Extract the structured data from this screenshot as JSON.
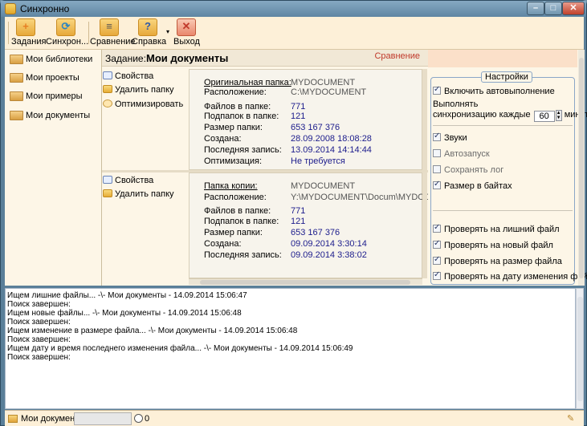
{
  "window": {
    "title": "Синхронно"
  },
  "toolbar": {
    "buttons": [
      {
        "label": "Задания",
        "icon": "plus-folder-icon",
        "glyph": "+",
        "color": "#e67e22"
      },
      {
        "label": "Синхрон...",
        "icon": "sync-folder-icon",
        "glyph": "⟳",
        "color": "#2e86c1"
      },
      {
        "label": "Сравнение",
        "icon": "compare-folder-icon",
        "glyph": "≡",
        "color": "#555555"
      },
      {
        "label": "Справка",
        "icon": "help-folder-icon",
        "glyph": "?",
        "color": "#2e5aa8"
      },
      {
        "label": "Выход",
        "icon": "exit-icon",
        "glyph": "✕",
        "color": "#c0392b"
      }
    ]
  },
  "libraries": [
    "Мои библиотеки",
    "Мои проекты",
    "Мои примеры",
    "Мои документы"
  ],
  "task": {
    "label": "Задание:",
    "name": "Мои документы",
    "mode": "Сравнение"
  },
  "original": {
    "actions": [
      "Свойства",
      "Удалить папку",
      "Оптимизировать"
    ],
    "title_key": "Оригинальная папка:",
    "title_val": "MYDOCUMENT",
    "location_key": "Расположение:",
    "location_val": "C:\\MYDOCUMENT",
    "files_key": "Файлов в папке:",
    "files_val": "771",
    "subfolders_key": "Подпапок в папке:",
    "subfolders_val": "121",
    "size_key": "Размер папки:",
    "size_val": "653 167 376",
    "created_key": "Создана:",
    "created_val": "28.09.2008 18:08:28",
    "modified_key": "Последняя запись:",
    "modified_val": "13.09.2014 14:14:44",
    "optimize_key": "Оптимизация:",
    "optimize_val": "Не требуется"
  },
  "copy": {
    "actions": [
      "Свойства",
      "Удалить папку"
    ],
    "title_key": "Папка копии:",
    "title_val": "MYDOCUMENT",
    "location_key": "Расположение:",
    "location_val": "Y:\\MYDOCUMENT\\Docum\\MYDOCUMEN",
    "files_key": "Файлов в папке:",
    "files_val": "771",
    "subfolders_key": "Подпапок в папке:",
    "subfolders_val": "121",
    "size_key": "Размер папки:",
    "size_val": "653 167 376",
    "created_key": "Создана:",
    "created_val": "09.09.2014 3:30:14",
    "modified_key": "Последняя запись:",
    "modified_val": "09.09.2014 3:38:02"
  },
  "settings": {
    "legend": "Настройки",
    "auto_run": {
      "label": "Включить автовыполнение",
      "checked": true
    },
    "sync_every_line1": "Выполнять",
    "sync_every_line2_prefix": "синхронизацию каждые",
    "sync_every_value": "60",
    "sync_every_unit": "минут",
    "sounds": {
      "label": "Звуки",
      "checked": true
    },
    "autostart": {
      "label": "Автозапуск",
      "checked": false
    },
    "save_log": {
      "label": "Сохранять лог",
      "checked": false
    },
    "size_bytes": {
      "label": "Размер в байтах",
      "checked": true
    },
    "check_extra": {
      "label": "Проверять на лишний файл",
      "checked": true
    },
    "check_new": {
      "label": "Проверять на новый файл",
      "checked": true
    },
    "check_size": {
      "label": "Проверять на размер файла",
      "checked": true
    },
    "check_date": {
      "label": "Проверять на дату изменения файла",
      "checked": true
    }
  },
  "log": [
    "Ищем лишние файлы... -\\- Мои документы - 14.09.2014 15:06:47",
    "Поиск завершен:",
    "Ищем новые файлы... -\\- Мои документы - 14.09.2014 15:06:48",
    "Поиск завершен:",
    "Ищем изменение в размере файла... -\\- Мои документы - 14.09.2014 15:06:48",
    "Поиск завершен:",
    "Ищем дату и время последнего изменения файла... -\\- Мои документы - 14.09.2014 15:06:49",
    "Поиск завершен:"
  ],
  "statusbar": {
    "label": "Мои документы",
    "count": "0"
  }
}
